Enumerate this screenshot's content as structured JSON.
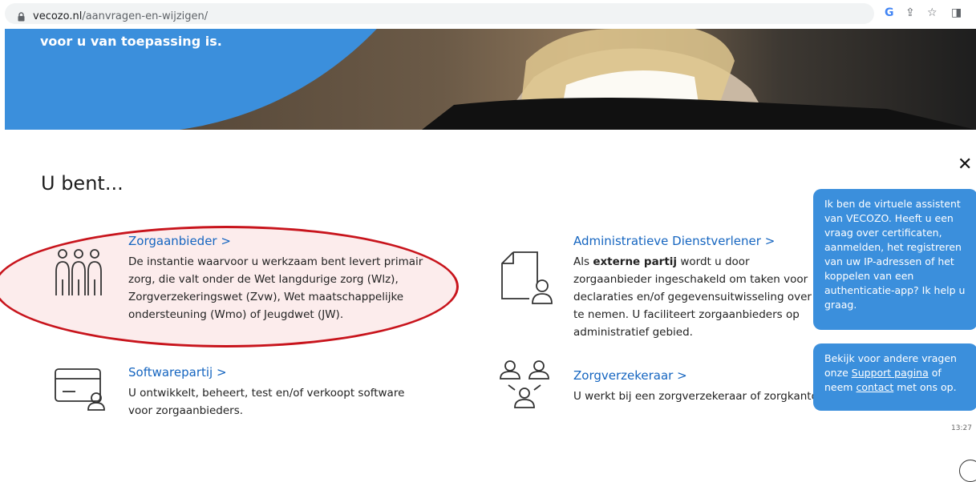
{
  "browser": {
    "domain": "vecozo.nl",
    "path": "/aanvragen-en-wijzigen/"
  },
  "hero": {
    "text": "voor u van toepassing is."
  },
  "heading": "U bent...",
  "cards": [
    {
      "title": "Zorgaanbieder",
      "desc": "De instantie waarvoor u werkzaam bent levert primair zorg, die valt onder de Wet langdurige zorg (Wlz), Zorgverzekeringswet (Zvw), Wet maatschappelijke ondersteuning (Wmo) of Jeugdwet (JW)."
    },
    {
      "title": "Administratieve Dienstverlener",
      "desc_bold": "externe partij",
      "desc_pre": "Als ",
      "desc_post": " wordt u door zorgaanbieder ingeschakeld om taken voor declaraties en/of gegevensuitwisseling over te nemen. U faciliteert zorgaanbieders op administratief gebied."
    },
    {
      "title": "Softwarepartij",
      "desc": "U ontwikkelt, beheert, test en/of verkoopt software voor zorgaanbieders."
    },
    {
      "title": "Zorgverzekeraar",
      "desc": "U werkt bij een zorgverzekeraar of zorgkantoor."
    }
  ],
  "chat": {
    "bubble1": "Ik ben de virtuele assistent van VECOZO. Heeft u een vraag over certificaten, aanmelden, het registreren van uw IP-adressen of het koppelen van een authenticatie-app? Ik help u graag.",
    "bubble2_pre": "Bekijk voor andere vragen onze ",
    "bubble2_link1": "Support pagina",
    "bubble2_mid": " of neem ",
    "bubble2_link2": "contact",
    "bubble2_post": " met ons op.",
    "time": "13:27",
    "close": "✕"
  },
  "chevron": ">",
  "colors": {
    "accent": "#3b8fdc",
    "link": "#1565c0",
    "highlight": "#c8141c"
  }
}
